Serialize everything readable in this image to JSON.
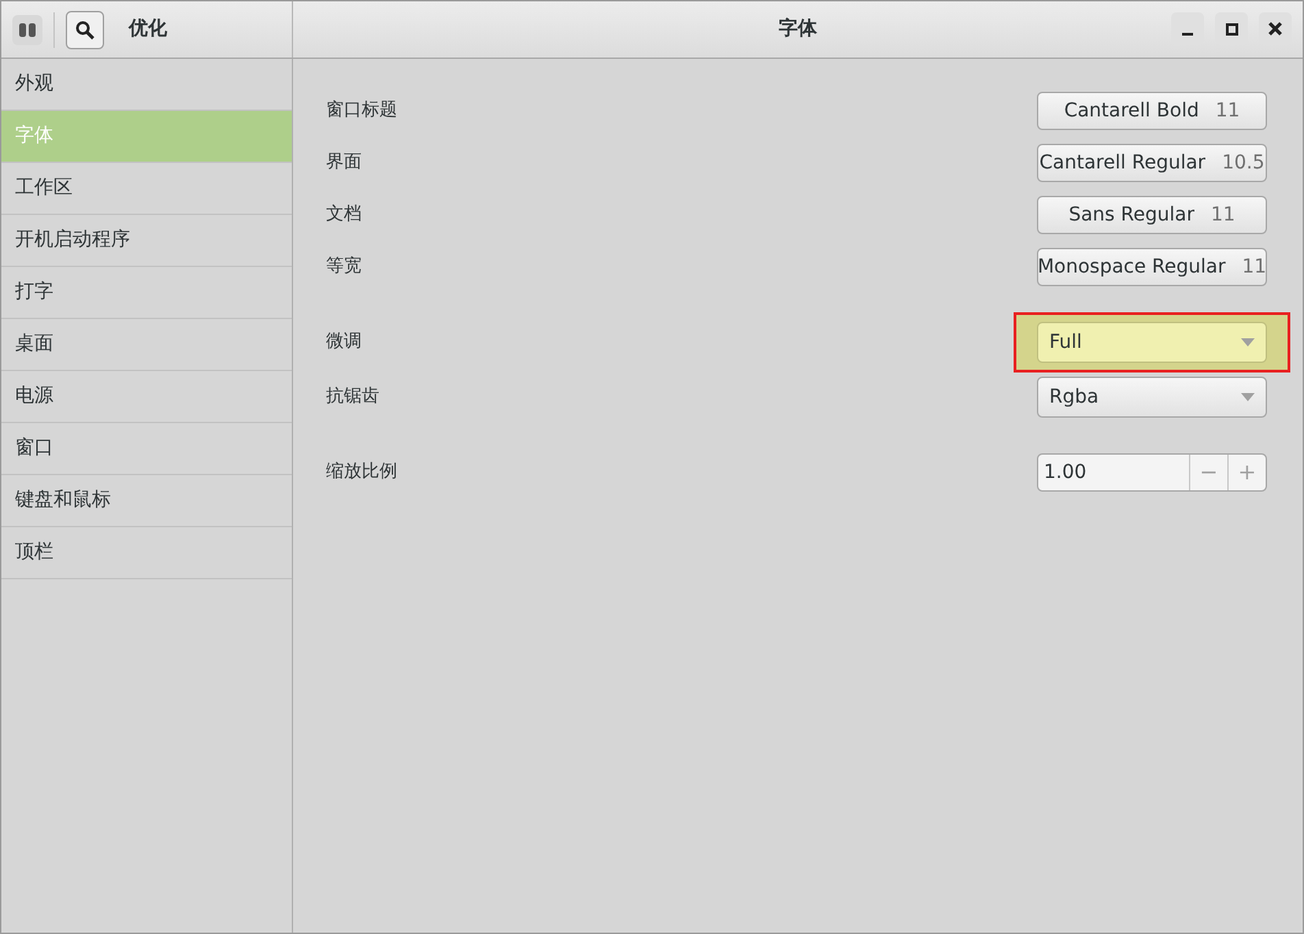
{
  "header": {
    "app_title": "优化",
    "page_title": "字体"
  },
  "sidebar": {
    "items": [
      {
        "label": "外观",
        "selected": false
      },
      {
        "label": "字体",
        "selected": true
      },
      {
        "label": "工作区",
        "selected": false
      },
      {
        "label": "开机启动程序",
        "selected": false
      },
      {
        "label": "打字",
        "selected": false
      },
      {
        "label": "桌面",
        "selected": false
      },
      {
        "label": "电源",
        "selected": false
      },
      {
        "label": "窗口",
        "selected": false
      },
      {
        "label": "键盘和鼠标",
        "selected": false
      },
      {
        "label": "顶栏",
        "selected": false
      }
    ]
  },
  "groups": [
    [
      {
        "kind": "font",
        "label": "窗口标题",
        "font": "Cantarell Bold",
        "size": "11"
      },
      {
        "kind": "font",
        "label": "界面",
        "font": "Cantarell Regular",
        "size": "10.5"
      },
      {
        "kind": "font",
        "label": "文档",
        "font": "Sans Regular",
        "size": "11"
      },
      {
        "kind": "font",
        "label": "等宽",
        "font": "Monospace Regular",
        "size": "11"
      }
    ],
    [
      {
        "kind": "combo",
        "label": "微调",
        "value": "Full",
        "highlighted": true
      },
      {
        "kind": "combo",
        "label": "抗锯齿",
        "value": "Rgba",
        "highlighted": false
      }
    ],
    [
      {
        "kind": "spin",
        "label": "缩放比例",
        "value": "1.00",
        "minus": "−",
        "plus": "+"
      }
    ]
  ]
}
